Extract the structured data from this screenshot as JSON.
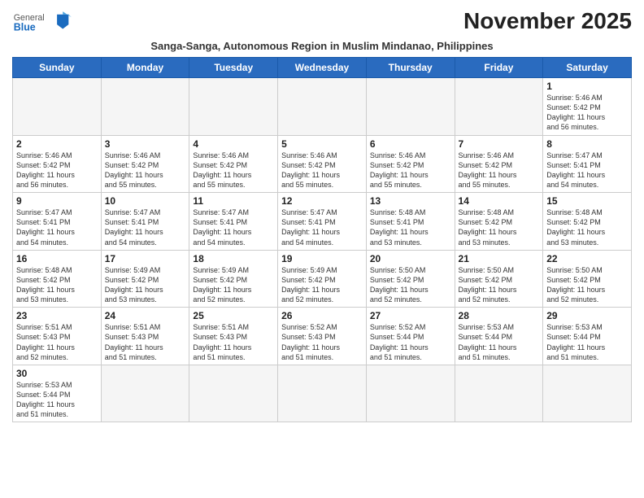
{
  "header": {
    "logo_general": "General",
    "logo_blue": "Blue",
    "title": "November 2025",
    "subtitle": "Sanga-Sanga, Autonomous Region in Muslim Mindanao, Philippines"
  },
  "weekdays": [
    "Sunday",
    "Monday",
    "Tuesday",
    "Wednesday",
    "Thursday",
    "Friday",
    "Saturday"
  ],
  "weeks": [
    [
      {
        "day": "",
        "info": ""
      },
      {
        "day": "",
        "info": ""
      },
      {
        "day": "",
        "info": ""
      },
      {
        "day": "",
        "info": ""
      },
      {
        "day": "",
        "info": ""
      },
      {
        "day": "",
        "info": ""
      },
      {
        "day": "1",
        "info": "Sunrise: 5:46 AM\nSunset: 5:42 PM\nDaylight: 11 hours\nand 56 minutes."
      }
    ],
    [
      {
        "day": "2",
        "info": "Sunrise: 5:46 AM\nSunset: 5:42 PM\nDaylight: 11 hours\nand 56 minutes."
      },
      {
        "day": "3",
        "info": "Sunrise: 5:46 AM\nSunset: 5:42 PM\nDaylight: 11 hours\nand 55 minutes."
      },
      {
        "day": "4",
        "info": "Sunrise: 5:46 AM\nSunset: 5:42 PM\nDaylight: 11 hours\nand 55 minutes."
      },
      {
        "day": "5",
        "info": "Sunrise: 5:46 AM\nSunset: 5:42 PM\nDaylight: 11 hours\nand 55 minutes."
      },
      {
        "day": "6",
        "info": "Sunrise: 5:46 AM\nSunset: 5:42 PM\nDaylight: 11 hours\nand 55 minutes."
      },
      {
        "day": "7",
        "info": "Sunrise: 5:46 AM\nSunset: 5:42 PM\nDaylight: 11 hours\nand 55 minutes."
      },
      {
        "day": "8",
        "info": "Sunrise: 5:47 AM\nSunset: 5:41 PM\nDaylight: 11 hours\nand 54 minutes."
      }
    ],
    [
      {
        "day": "9",
        "info": "Sunrise: 5:47 AM\nSunset: 5:41 PM\nDaylight: 11 hours\nand 54 minutes."
      },
      {
        "day": "10",
        "info": "Sunrise: 5:47 AM\nSunset: 5:41 PM\nDaylight: 11 hours\nand 54 minutes."
      },
      {
        "day": "11",
        "info": "Sunrise: 5:47 AM\nSunset: 5:41 PM\nDaylight: 11 hours\nand 54 minutes."
      },
      {
        "day": "12",
        "info": "Sunrise: 5:47 AM\nSunset: 5:41 PM\nDaylight: 11 hours\nand 54 minutes."
      },
      {
        "day": "13",
        "info": "Sunrise: 5:48 AM\nSunset: 5:41 PM\nDaylight: 11 hours\nand 53 minutes."
      },
      {
        "day": "14",
        "info": "Sunrise: 5:48 AM\nSunset: 5:42 PM\nDaylight: 11 hours\nand 53 minutes."
      },
      {
        "day": "15",
        "info": "Sunrise: 5:48 AM\nSunset: 5:42 PM\nDaylight: 11 hours\nand 53 minutes."
      }
    ],
    [
      {
        "day": "16",
        "info": "Sunrise: 5:48 AM\nSunset: 5:42 PM\nDaylight: 11 hours\nand 53 minutes."
      },
      {
        "day": "17",
        "info": "Sunrise: 5:49 AM\nSunset: 5:42 PM\nDaylight: 11 hours\nand 53 minutes."
      },
      {
        "day": "18",
        "info": "Sunrise: 5:49 AM\nSunset: 5:42 PM\nDaylight: 11 hours\nand 52 minutes."
      },
      {
        "day": "19",
        "info": "Sunrise: 5:49 AM\nSunset: 5:42 PM\nDaylight: 11 hours\nand 52 minutes."
      },
      {
        "day": "20",
        "info": "Sunrise: 5:50 AM\nSunset: 5:42 PM\nDaylight: 11 hours\nand 52 minutes."
      },
      {
        "day": "21",
        "info": "Sunrise: 5:50 AM\nSunset: 5:42 PM\nDaylight: 11 hours\nand 52 minutes."
      },
      {
        "day": "22",
        "info": "Sunrise: 5:50 AM\nSunset: 5:42 PM\nDaylight: 11 hours\nand 52 minutes."
      }
    ],
    [
      {
        "day": "23",
        "info": "Sunrise: 5:51 AM\nSunset: 5:43 PM\nDaylight: 11 hours\nand 52 minutes."
      },
      {
        "day": "24",
        "info": "Sunrise: 5:51 AM\nSunset: 5:43 PM\nDaylight: 11 hours\nand 51 minutes."
      },
      {
        "day": "25",
        "info": "Sunrise: 5:51 AM\nSunset: 5:43 PM\nDaylight: 11 hours\nand 51 minutes."
      },
      {
        "day": "26",
        "info": "Sunrise: 5:52 AM\nSunset: 5:43 PM\nDaylight: 11 hours\nand 51 minutes."
      },
      {
        "day": "27",
        "info": "Sunrise: 5:52 AM\nSunset: 5:44 PM\nDaylight: 11 hours\nand 51 minutes."
      },
      {
        "day": "28",
        "info": "Sunrise: 5:53 AM\nSunset: 5:44 PM\nDaylight: 11 hours\nand 51 minutes."
      },
      {
        "day": "29",
        "info": "Sunrise: 5:53 AM\nSunset: 5:44 PM\nDaylight: 11 hours\nand 51 minutes."
      }
    ],
    [
      {
        "day": "30",
        "info": "Sunrise: 5:53 AM\nSunset: 5:44 PM\nDaylight: 11 hours\nand 51 minutes."
      },
      {
        "day": "",
        "info": ""
      },
      {
        "day": "",
        "info": ""
      },
      {
        "day": "",
        "info": ""
      },
      {
        "day": "",
        "info": ""
      },
      {
        "day": "",
        "info": ""
      },
      {
        "day": "",
        "info": ""
      }
    ]
  ]
}
